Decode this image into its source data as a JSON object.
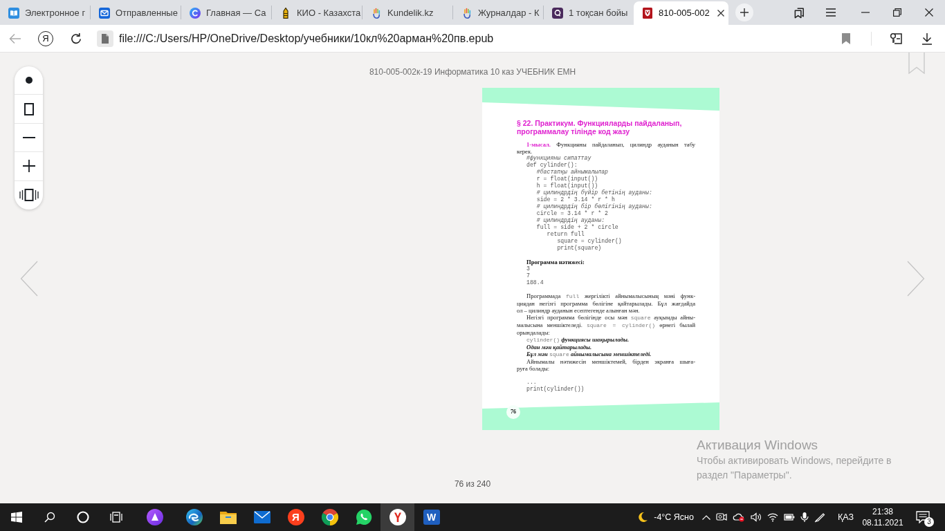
{
  "tabs": [
    {
      "title": "Электронное г",
      "selected": false
    },
    {
      "title": "Отправленные",
      "selected": false
    },
    {
      "title": "Главная — Са",
      "selected": false
    },
    {
      "title": "КИО - Казахста",
      "selected": false
    },
    {
      "title": "Kundelik.kz",
      "selected": false
    },
    {
      "title": "Журналдар - К",
      "selected": false
    },
    {
      "title": "1 тоқсан бойы",
      "selected": false
    },
    {
      "title": "810-005-002",
      "selected": true
    }
  ],
  "address_bar": {
    "back_disabled": true,
    "home_glyph": "Я",
    "url": "file:///C:/Users/HP/OneDrive/Desktop/учебники/10кл%20арман%20пв.epub"
  },
  "viewer": {
    "book_title": "810-005-002к-19 Информатика 10 каз УЧЕБНИК ЕМН",
    "page": {
      "heading": "§ 22. Практикум. Функцияларды пайдаланып, программалау тілінде код жазу",
      "blocks": [
        {
          "kind": "task",
          "lines": [
            [
              {
                "kind": "label",
                "text": "1-мысал."
              },
              {
                "kind": "text",
                "text": " Функцияны пайдаланып, цилиндр ауданын табу"
              }
            ],
            [
              {
                "kind": "text",
                "text": "керек."
              }
            ]
          ]
        },
        {
          "kind": "code",
          "lines": [
            {
              "kind": "comment",
              "text": "#функцияны сипаттау"
            },
            {
              "kind": "statement",
              "text": "def cylinder():",
              "children": [
                {
                  "kind": "comment",
                  "text": "#бастапқы айнымалылар"
                },
                {
                  "kind": "statement",
                  "text": "r = float(input())"
                },
                {
                  "kind": "statement",
                  "text": "h = float(input())"
                },
                {
                  "kind": "comment",
                  "text": "# цилиндрдің бүйір бетінің ауданы:"
                },
                {
                  "kind": "statement",
                  "text": "side = 2 * 3.14 * r * h"
                },
                {
                  "kind": "comment",
                  "text": "# цилиндрдің бір бөлігінің ауданы:"
                },
                {
                  "kind": "statement",
                  "text": "circle = 3.14 * r * 2"
                },
                {
                  "kind": "comment",
                  "text": "# цилиндрдің ауданы:"
                },
                {
                  "kind": "statement",
                  "text": "full = side + 2 * circle",
                  "children": [
                    {
                      "kind": "statement",
                      "text": "return full",
                      "children": [
                        {
                          "kind": "statement",
                          "text": "square = cylinder()"
                        },
                        {
                          "kind": "statement",
                          "text": "print(square)"
                        }
                      ]
                    }
                  ]
                }
              ]
            }
          ]
        },
        {
          "kind": "subheading",
          "text": "Программа нәтижесі:"
        },
        {
          "kind": "output",
          "lines": [
            "3",
            "7",
            "188.4"
          ]
        },
        {
          "kind": "paragraph",
          "lines": [
            [
              {
                "kind": "text",
                "text": "Программада "
              },
              {
                "kind": "code",
                "text": "full"
              },
              {
                "kind": "text",
                "text": " жергілікті айнымалысының мәні функ-"
              }
            ],
            [
              {
                "kind": "text",
                "text": "циядан негізгі программа бөлігіне қайтарылады. Бұл жағдайда"
              }
            ],
            [
              {
                "kind": "text",
                "text": "ол – цилиндр ауданын есептегенде алынған мән."
              }
            ]
          ]
        },
        {
          "kind": "paragraph",
          "lines": [
            [
              {
                "kind": "text",
                "text": "Негізгі программа бөлігінде осы мән "
              },
              {
                "kind": "code",
                "text": "square"
              },
              {
                "kind": "text",
                "text": " ауқымды айны-"
              }
            ],
            [
              {
                "kind": "text",
                "text": "малысына меншіктеледі. "
              },
              {
                "kind": "code",
                "text": "square = cylinder()"
              },
              {
                "kind": "text",
                "text": " өрнегі былай"
              }
            ],
            [
              {
                "kind": "text",
                "text": "орындалады:"
              }
            ]
          ]
        },
        {
          "kind": "paragraph",
          "lines": [
            [
              {
                "kind": "code",
                "text": "cylinder()"
              },
              {
                "kind": "emphasis",
                "text": " функциясы шақырылады."
              }
            ]
          ]
        },
        {
          "kind": "paragraph",
          "lines": [
            [
              {
                "kind": "emphasis",
                "text": "Одан мән қайтарылады."
              }
            ]
          ]
        },
        {
          "kind": "paragraph",
          "lines": [
            [
              {
                "kind": "emphasis",
                "text": "Бұл мән "
              },
              {
                "kind": "code",
                "text": "square"
              },
              {
                "kind": "emphasis",
                "text": " айнымалысына меншіктеледі."
              }
            ]
          ]
        },
        {
          "kind": "paragraph",
          "lines": [
            [
              {
                "kind": "text",
                "text": "Айнымалы нәтижесін меншіктемей, бірден экранға шыға-"
              }
            ],
            [
              {
                "kind": "text",
                "text": "руға болады:"
              }
            ]
          ]
        },
        {
          "kind": "code",
          "lines": [
            {
              "kind": "statement",
              "text": "..."
            },
            {
              "kind": "statement",
              "text": "print(cylinder())"
            }
          ]
        }
      ],
      "page_number": "76"
    },
    "page_counter": "76 из 240"
  },
  "activation_notice": {
    "title": "Активация Windows",
    "text": "Чтобы активировать Windows, перейдите в раздел \"Параметры\"."
  },
  "taskbar": {
    "apps": [
      {
        "selected": false
      },
      {
        "selected": false
      },
      {
        "selected": false
      },
      {
        "selected": false
      },
      {
        "glyph": "Я",
        "selected": false
      },
      {
        "selected": false
      },
      {
        "selected": false
      },
      {
        "selected": true
      },
      {
        "glyph": "W",
        "selected": false
      }
    ],
    "weather": "-4°C Ясно",
    "language": "ҚАЗ",
    "time": "21:38",
    "date": "08.11.2021",
    "notification_count": "3"
  }
}
